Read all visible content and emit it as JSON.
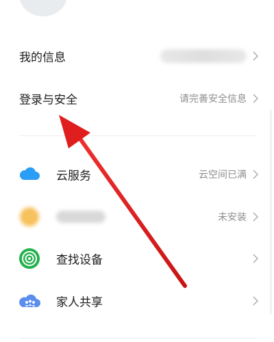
{
  "account": {
    "my_info": {
      "label": "我的信息"
    },
    "login_security": {
      "label": "登录与安全",
      "value": "请完善安全信息"
    }
  },
  "services": {
    "cloud": {
      "label": "云服务",
      "value": "云空间已满",
      "icon": "cloud-icon",
      "color": "#2a9df4"
    },
    "blurred_app": {
      "value": "未安装",
      "icon": "app-icon",
      "color": "#f7c15c"
    },
    "find_device": {
      "label": "查找设备",
      "icon": "radar-icon",
      "color": "#22b14c"
    },
    "family_sharing": {
      "label": "家人共享",
      "icon": "family-cloud-icon",
      "color": "#5b8def"
    }
  },
  "annotation": {
    "arrow_color": "#e01e1e"
  }
}
